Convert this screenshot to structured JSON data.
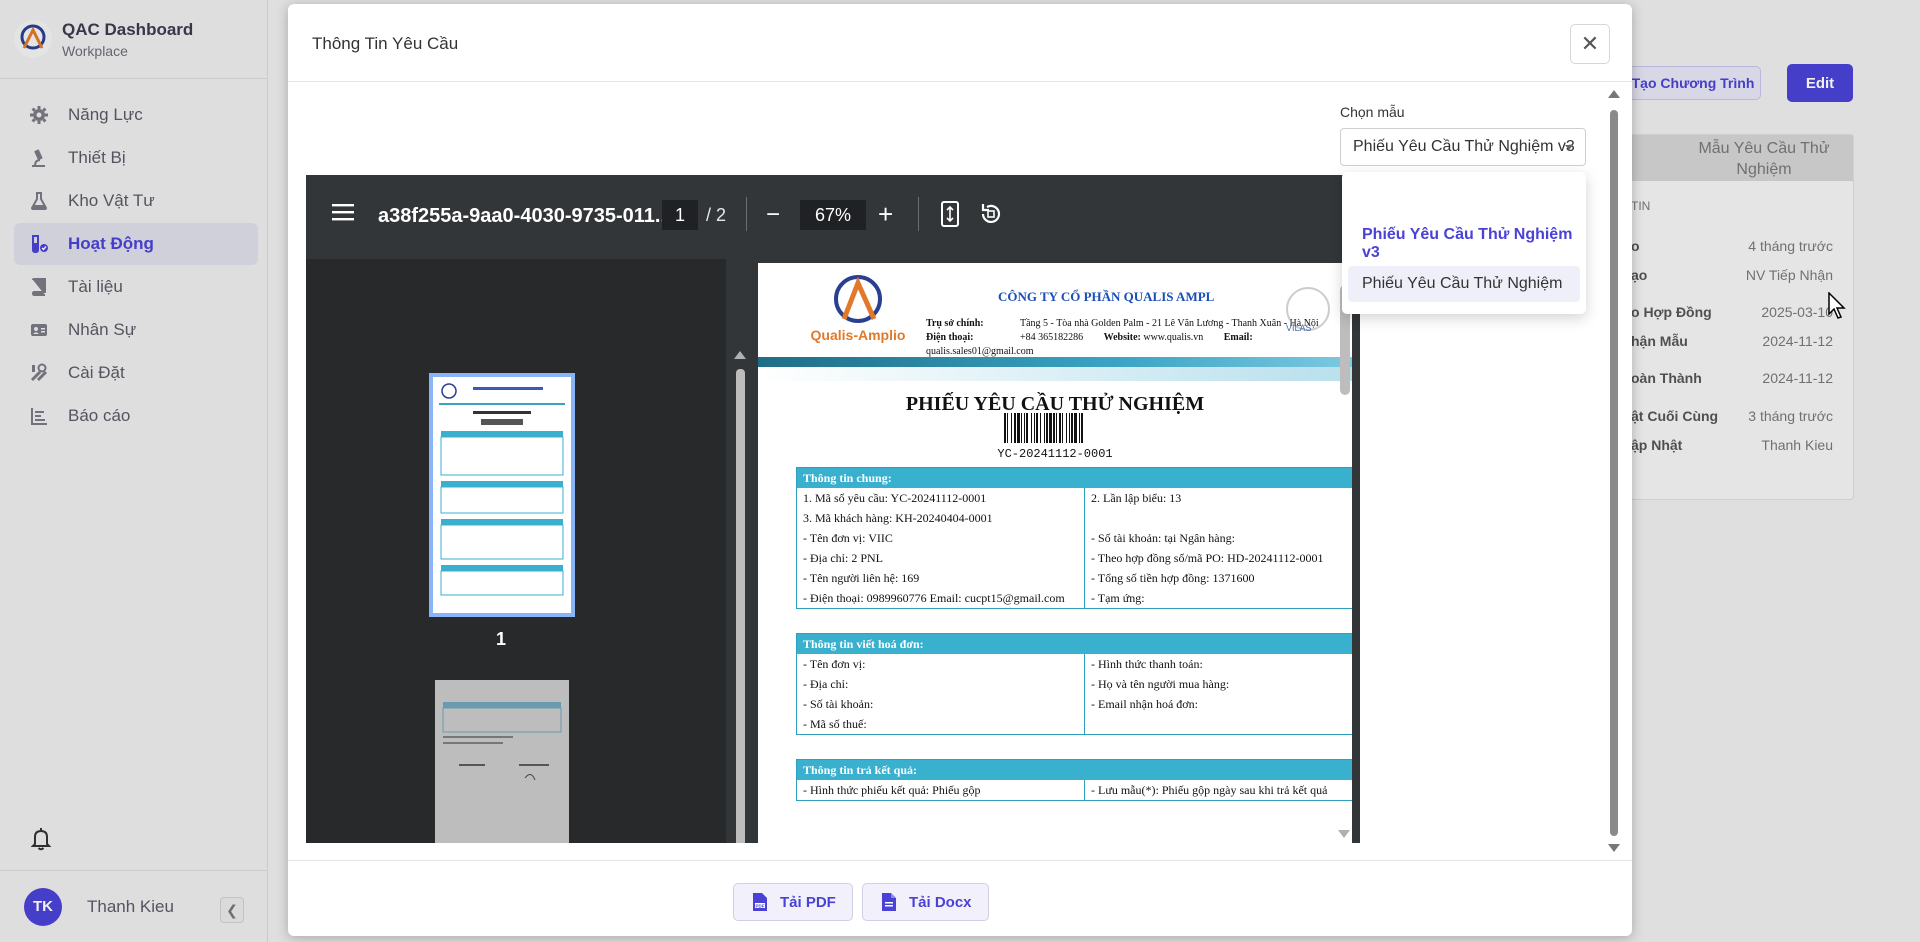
{
  "app": {
    "title": "QAC Dashboard",
    "subtitle": "Workplace"
  },
  "sidebar": {
    "items": [
      {
        "label": "Năng Lực",
        "icon": "gear-icon",
        "active": false
      },
      {
        "label": "Thiết Bị",
        "icon": "microscope-icon",
        "active": false
      },
      {
        "label": "Kho Vật Tư",
        "icon": "flask-icon",
        "active": false
      },
      {
        "label": "Hoạt Động",
        "icon": "flask-check-icon",
        "active": true
      },
      {
        "label": "Tài liệu",
        "icon": "book-icon",
        "active": false
      },
      {
        "label": "Nhân Sự",
        "icon": "id-card-icon",
        "active": false
      },
      {
        "label": "Cài Đặt",
        "icon": "tools-icon",
        "active": false
      },
      {
        "label": "Báo cáo",
        "icon": "report-icon",
        "active": false
      }
    ],
    "user": {
      "initials": "TK",
      "name": "Thanh Kieu"
    }
  },
  "background": {
    "create_program_label": "Tạo Chương Trình",
    "edit_label": "Edit",
    "card_tab": "Mẫu Yêu Cầu Thử Nghiệm",
    "section_label": "TIN",
    "rows": [
      {
        "key": "o",
        "value": "4 tháng trước"
      },
      {
        "key": "ạo",
        "value": "NV Tiếp Nhận"
      },
      {
        "key": "o Hợp Đồng",
        "value": "2025-03-10"
      },
      {
        "key": "hận Mẫu",
        "value": "2024-11-12"
      },
      {
        "key": "oàn Thành",
        "value": "2024-11-12"
      },
      {
        "key": "ật Cuối Cùng",
        "value": "3 tháng trước"
      },
      {
        "key": "ập Nhật",
        "value": "Thanh Kieu"
      }
    ]
  },
  "modal": {
    "title": "Thông Tin Yêu Cầu",
    "template_label": "Chọn mẫu",
    "template_value": "Phiếu Yêu Cầu Thử Nghiệm v3",
    "template_options": [
      "Phiếu Yêu Cầu Thử Nghiệm v3",
      "Phiếu Yêu Cầu Thử Nghiệm"
    ],
    "pdf_button": "Tải PDF",
    "docx_button": "Tải Docx"
  },
  "viewer": {
    "filename": "a38f255a-9aa0-4030-9735-011...",
    "page": "1",
    "page_total": "/ 2",
    "zoom": "67%",
    "thumb_label": "1"
  },
  "document": {
    "logo_text": "Qualis-Amplio",
    "company": "CÔNG TY CỔ PHẦN QUALIS AMPL",
    "addr_label": "Trụ sở chính:",
    "addr": "Tầng 5 - Tòa nhà Golden Palm - 21 Lê Văn Lương - Thanh Xuân - Hà Nội",
    "phone_label": "Điện thoại:",
    "phone": "+84 365182286",
    "website_label": "Website:",
    "website": "www.qualis.vn",
    "email_label": "Email:",
    "email": "qualis.sales01@gmail.com",
    "vilas": "VILAS",
    "title": "PHIẾU YÊU CẦU THỬ NGHIỆM",
    "code": "YC-20241112-0001",
    "sections": [
      {
        "header": "Thông tin chung:",
        "left": [
          "1. Mã số yêu cầu: YC-20241112-0001",
          "3. Mã khách hàng: KH-20240404-0001",
          "- Tên đơn vị: VIIC",
          "- Địa chỉ: 2 PNL",
          "- Tên người liên hệ: 169",
          "- Điện thoại: 0989960776  Email: cucpt15@gmail.com"
        ],
        "right": [
          "2. Lần lập biểu:  13",
          "",
          "- Số tài khoản:   tại Ngân hàng:",
          "- Theo hợp đồng số/mã PO: HD-20241112-0001",
          "- Tổng số tiền hợp đồng: 1371600",
          "- Tạm ứng:"
        ]
      },
      {
        "header": "Thông tin viết hoá đơn:",
        "left": [
          "- Tên đơn vị:",
          "- Địa chỉ:",
          "- Số tài khoản:",
          "- Mã số thuế:"
        ],
        "right": [
          "- Hình thức thanh toán:",
          "- Họ và tên người mua hàng:",
          "- Email nhận hoá đơn:",
          ""
        ]
      },
      {
        "header": "Thông tin trả kết quả:",
        "left": [
          "- Hình thức phiếu kết quả: Phiếu gộp"
        ],
        "right": [
          "- Lưu mẫu(*): Phiếu gộp  ngày sau khi trả kết quả"
        ]
      }
    ]
  }
}
